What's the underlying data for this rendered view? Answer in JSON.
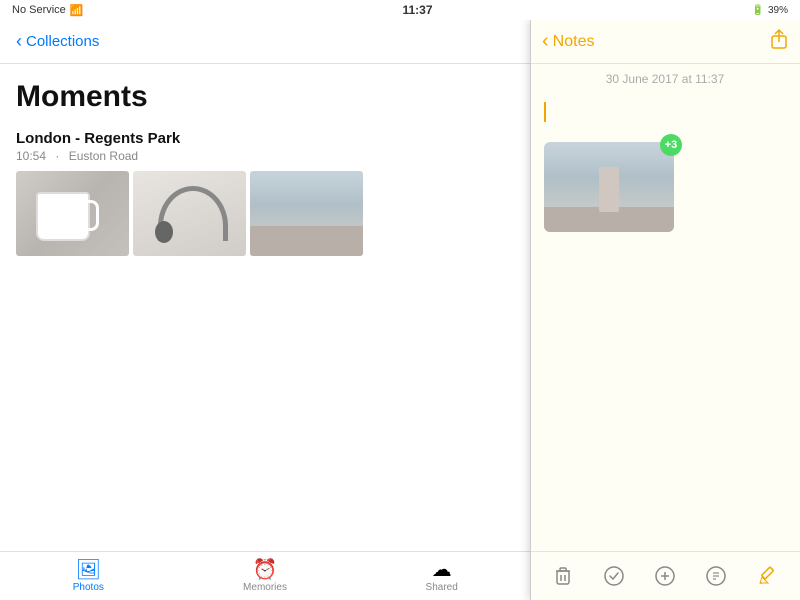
{
  "status_bar": {
    "left": "No Service",
    "time": "11:37",
    "right": "39%"
  },
  "photos": {
    "back_label": "Collections",
    "page_title": "Moments",
    "location_name": "London - Regents Park",
    "location_time": "10:54",
    "location_dot": "·",
    "location_street": "Euston Road",
    "tabs": [
      {
        "id": "photos",
        "label": "Photos",
        "active": true
      },
      {
        "id": "memories",
        "label": "Memories",
        "active": false
      },
      {
        "id": "shared",
        "label": "Shared",
        "active": false
      }
    ]
  },
  "notes": {
    "back_label": "Notes",
    "date_label": "30 June 2017 at 11:37",
    "badge_count": "+3",
    "toolbar": {
      "delete": "🗑",
      "checkmark": "✓",
      "add": "+",
      "compose": "✎",
      "pencil": "✏"
    }
  }
}
